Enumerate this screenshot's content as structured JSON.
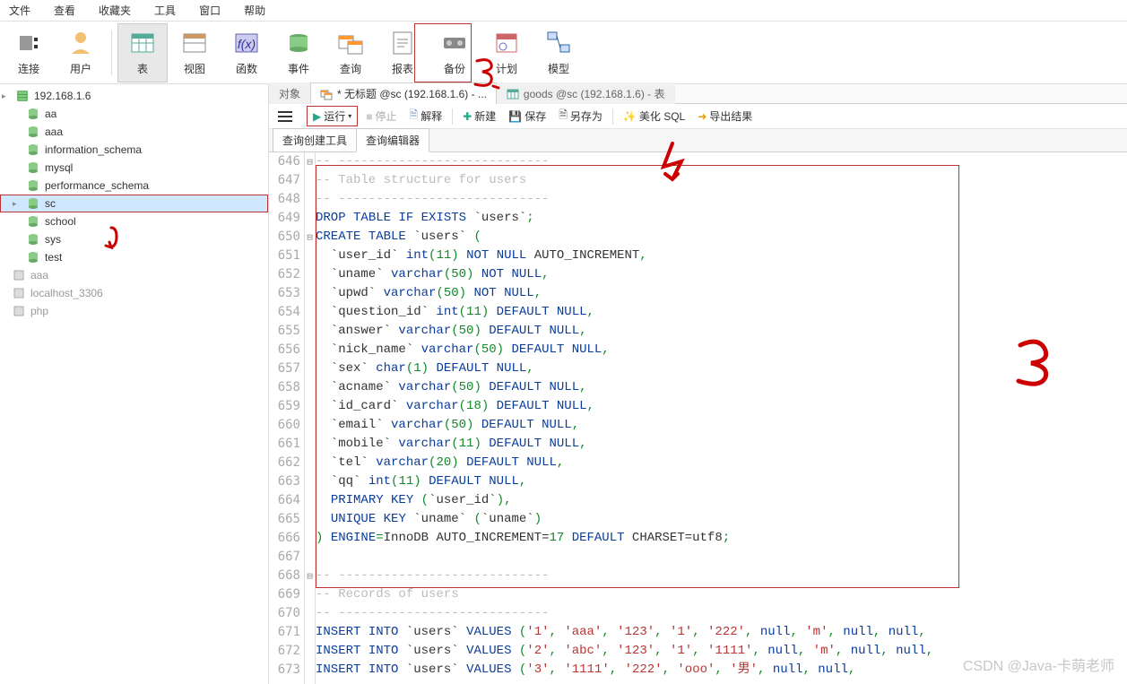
{
  "menubar": [
    "文件",
    "查看",
    "收藏夹",
    "工具",
    "窗口",
    "帮助"
  ],
  "main_toolbar": [
    {
      "label": "连接",
      "icon": "plug",
      "selected": false
    },
    {
      "label": "用户",
      "icon": "user",
      "selected": false
    },
    {
      "sep": true
    },
    {
      "label": "表",
      "icon": "table",
      "selected": true
    },
    {
      "label": "视图",
      "icon": "view",
      "selected": false
    },
    {
      "label": "函数",
      "icon": "fx",
      "selected": false
    },
    {
      "label": "事件",
      "icon": "event",
      "selected": false
    },
    {
      "label": "查询",
      "icon": "query",
      "selected": false
    },
    {
      "label": "报表",
      "icon": "report",
      "selected": false
    },
    {
      "label": "备份",
      "icon": "backup",
      "selected": false
    },
    {
      "label": "计划",
      "icon": "plan",
      "selected": false
    },
    {
      "label": "模型",
      "icon": "model",
      "selected": false
    }
  ],
  "sidebar": {
    "connection": "192.168.1.6",
    "databases": [
      {
        "name": "aa",
        "open": true
      },
      {
        "name": "aaa",
        "open": true
      },
      {
        "name": "information_schema",
        "open": true
      },
      {
        "name": "mysql",
        "open": true
      },
      {
        "name": "performance_schema",
        "open": true
      },
      {
        "name": "sc",
        "open": true,
        "selected": true,
        "boxed": true
      },
      {
        "name": "school",
        "open": true
      },
      {
        "name": "sys",
        "open": true
      },
      {
        "name": "test",
        "open": true
      }
    ],
    "other_conns": [
      "aaa",
      "localhost_3306",
      "php"
    ]
  },
  "tabs": [
    {
      "label": "对象",
      "active": false,
      "type": "normal"
    },
    {
      "label": "* 无标题 @sc (192.168.1.6) - ...",
      "active": true,
      "type": "query"
    },
    {
      "label": "goods @sc (192.168.1.6) - 表",
      "active": false,
      "type": "table"
    }
  ],
  "query_toolbar": {
    "run": "运行",
    "stop": "停止",
    "explain": "解释",
    "new": "新建",
    "save": "保存",
    "saveas": "另存为",
    "beautify": "美化 SQL",
    "export": "导出结果"
  },
  "subtabs": {
    "builder": "查询创建工具",
    "editor": "查询编辑器"
  },
  "line_start": 646,
  "code": [
    {
      "fold": "⊟",
      "tokens": [
        {
          "t": "-- ----------------------------",
          "c": "gy"
        }
      ]
    },
    {
      "tokens": [
        {
          "t": "-- Table structure for users",
          "c": "gy"
        }
      ]
    },
    {
      "tokens": [
        {
          "t": "-- ----------------------------",
          "c": "gy"
        }
      ]
    },
    {
      "tokens": [
        {
          "t": "DROP",
          "c": "kw"
        },
        {
          "t": " "
        },
        {
          "t": "TABLE",
          "c": "kw"
        },
        {
          "t": " "
        },
        {
          "t": "IF",
          "c": "kw"
        },
        {
          "t": " "
        },
        {
          "t": "EXISTS",
          "c": "kw"
        },
        {
          "t": " `users`"
        },
        {
          "t": ";",
          "c": "op"
        }
      ]
    },
    {
      "fold": "⊟",
      "tokens": [
        {
          "t": "CREATE",
          "c": "kw"
        },
        {
          "t": " "
        },
        {
          "t": "TABLE",
          "c": "kw"
        },
        {
          "t": " `users` "
        },
        {
          "t": "(",
          "c": "op"
        }
      ]
    },
    {
      "tokens": [
        {
          "t": "  `user_id` "
        },
        {
          "t": "int",
          "c": "ty"
        },
        {
          "t": "(",
          "c": "op"
        },
        {
          "t": "11",
          "c": "nm"
        },
        {
          "t": ")",
          "c": "op"
        },
        {
          "t": " "
        },
        {
          "t": "NOT",
          "c": "kw"
        },
        {
          "t": " "
        },
        {
          "t": "NULL",
          "c": "kw"
        },
        {
          "t": " AUTO_INCREMENT"
        },
        {
          "t": ",",
          "c": "op"
        }
      ]
    },
    {
      "tokens": [
        {
          "t": "  `uname` "
        },
        {
          "t": "varchar",
          "c": "ty"
        },
        {
          "t": "(",
          "c": "op"
        },
        {
          "t": "50",
          "c": "nm"
        },
        {
          "t": ")",
          "c": "op"
        },
        {
          "t": " "
        },
        {
          "t": "NOT",
          "c": "kw"
        },
        {
          "t": " "
        },
        {
          "t": "NULL",
          "c": "kw"
        },
        {
          "t": ",",
          "c": "op"
        }
      ]
    },
    {
      "tokens": [
        {
          "t": "  `upwd` "
        },
        {
          "t": "varchar",
          "c": "ty"
        },
        {
          "t": "(",
          "c": "op"
        },
        {
          "t": "50",
          "c": "nm"
        },
        {
          "t": ")",
          "c": "op"
        },
        {
          "t": " "
        },
        {
          "t": "NOT",
          "c": "kw"
        },
        {
          "t": " "
        },
        {
          "t": "NULL",
          "c": "kw"
        },
        {
          "t": ",",
          "c": "op"
        }
      ]
    },
    {
      "tokens": [
        {
          "t": "  `question_id` "
        },
        {
          "t": "int",
          "c": "ty"
        },
        {
          "t": "(",
          "c": "op"
        },
        {
          "t": "11",
          "c": "nm"
        },
        {
          "t": ")",
          "c": "op"
        },
        {
          "t": " "
        },
        {
          "t": "DEFAULT",
          "c": "kw"
        },
        {
          "t": " "
        },
        {
          "t": "NULL",
          "c": "kw"
        },
        {
          "t": ",",
          "c": "op"
        }
      ]
    },
    {
      "tokens": [
        {
          "t": "  `answer` "
        },
        {
          "t": "varchar",
          "c": "ty"
        },
        {
          "t": "(",
          "c": "op"
        },
        {
          "t": "50",
          "c": "nm"
        },
        {
          "t": ")",
          "c": "op"
        },
        {
          "t": " "
        },
        {
          "t": "DEFAULT",
          "c": "kw"
        },
        {
          "t": " "
        },
        {
          "t": "NULL",
          "c": "kw"
        },
        {
          "t": ",",
          "c": "op"
        }
      ]
    },
    {
      "tokens": [
        {
          "t": "  `nick_name` "
        },
        {
          "t": "varchar",
          "c": "ty"
        },
        {
          "t": "(",
          "c": "op"
        },
        {
          "t": "50",
          "c": "nm"
        },
        {
          "t": ")",
          "c": "op"
        },
        {
          "t": " "
        },
        {
          "t": "DEFAULT",
          "c": "kw"
        },
        {
          "t": " "
        },
        {
          "t": "NULL",
          "c": "kw"
        },
        {
          "t": ",",
          "c": "op"
        }
      ]
    },
    {
      "tokens": [
        {
          "t": "  `sex` "
        },
        {
          "t": "char",
          "c": "ty"
        },
        {
          "t": "(",
          "c": "op"
        },
        {
          "t": "1",
          "c": "nm"
        },
        {
          "t": ")",
          "c": "op"
        },
        {
          "t": " "
        },
        {
          "t": "DEFAULT",
          "c": "kw"
        },
        {
          "t": " "
        },
        {
          "t": "NULL",
          "c": "kw"
        },
        {
          "t": ",",
          "c": "op"
        }
      ]
    },
    {
      "tokens": [
        {
          "t": "  `acname` "
        },
        {
          "t": "varchar",
          "c": "ty"
        },
        {
          "t": "(",
          "c": "op"
        },
        {
          "t": "50",
          "c": "nm"
        },
        {
          "t": ")",
          "c": "op"
        },
        {
          "t": " "
        },
        {
          "t": "DEFAULT",
          "c": "kw"
        },
        {
          "t": " "
        },
        {
          "t": "NULL",
          "c": "kw"
        },
        {
          "t": ",",
          "c": "op"
        }
      ]
    },
    {
      "tokens": [
        {
          "t": "  `id_card` "
        },
        {
          "t": "varchar",
          "c": "ty"
        },
        {
          "t": "(",
          "c": "op"
        },
        {
          "t": "18",
          "c": "nm"
        },
        {
          "t": ")",
          "c": "op"
        },
        {
          "t": " "
        },
        {
          "t": "DEFAULT",
          "c": "kw"
        },
        {
          "t": " "
        },
        {
          "t": "NULL",
          "c": "kw"
        },
        {
          "t": ",",
          "c": "op"
        }
      ]
    },
    {
      "tokens": [
        {
          "t": "  `email` "
        },
        {
          "t": "varchar",
          "c": "ty"
        },
        {
          "t": "(",
          "c": "op"
        },
        {
          "t": "50",
          "c": "nm"
        },
        {
          "t": ")",
          "c": "op"
        },
        {
          "t": " "
        },
        {
          "t": "DEFAULT",
          "c": "kw"
        },
        {
          "t": " "
        },
        {
          "t": "NULL",
          "c": "kw"
        },
        {
          "t": ",",
          "c": "op"
        }
      ]
    },
    {
      "tokens": [
        {
          "t": "  `mobile` "
        },
        {
          "t": "varchar",
          "c": "ty"
        },
        {
          "t": "(",
          "c": "op"
        },
        {
          "t": "11",
          "c": "nm"
        },
        {
          "t": ")",
          "c": "op"
        },
        {
          "t": " "
        },
        {
          "t": "DEFAULT",
          "c": "kw"
        },
        {
          "t": " "
        },
        {
          "t": "NULL",
          "c": "kw"
        },
        {
          "t": ",",
          "c": "op"
        }
      ]
    },
    {
      "tokens": [
        {
          "t": "  `tel` "
        },
        {
          "t": "varchar",
          "c": "ty"
        },
        {
          "t": "(",
          "c": "op"
        },
        {
          "t": "20",
          "c": "nm"
        },
        {
          "t": ")",
          "c": "op"
        },
        {
          "t": " "
        },
        {
          "t": "DEFAULT",
          "c": "kw"
        },
        {
          "t": " "
        },
        {
          "t": "NULL",
          "c": "kw"
        },
        {
          "t": ",",
          "c": "op"
        }
      ]
    },
    {
      "tokens": [
        {
          "t": "  `qq` "
        },
        {
          "t": "int",
          "c": "ty"
        },
        {
          "t": "(",
          "c": "op"
        },
        {
          "t": "11",
          "c": "nm"
        },
        {
          "t": ")",
          "c": "op"
        },
        {
          "t": " "
        },
        {
          "t": "DEFAULT",
          "c": "kw"
        },
        {
          "t": " "
        },
        {
          "t": "NULL",
          "c": "kw"
        },
        {
          "t": ",",
          "c": "op"
        }
      ]
    },
    {
      "tokens": [
        {
          "t": "  "
        },
        {
          "t": "PRIMARY",
          "c": "kw"
        },
        {
          "t": " "
        },
        {
          "t": "KEY",
          "c": "kw"
        },
        {
          "t": " "
        },
        {
          "t": "(",
          "c": "op"
        },
        {
          "t": "`user_id`"
        },
        {
          "t": ")",
          "c": "op"
        },
        {
          "t": ",",
          "c": "op"
        }
      ]
    },
    {
      "tokens": [
        {
          "t": "  "
        },
        {
          "t": "UNIQUE",
          "c": "kw"
        },
        {
          "t": " "
        },
        {
          "t": "KEY",
          "c": "kw"
        },
        {
          "t": " `uname` "
        },
        {
          "t": "(",
          "c": "op"
        },
        {
          "t": "`uname`"
        },
        {
          "t": ")",
          "c": "op"
        }
      ]
    },
    {
      "tokens": [
        {
          "t": ")",
          "c": "op"
        },
        {
          "t": " "
        },
        {
          "t": "ENGINE",
          "c": "kw"
        },
        {
          "t": "=",
          "c": "op"
        },
        {
          "t": "InnoDB"
        },
        {
          "t": " AUTO_INCREMENT="
        },
        {
          "t": "17",
          "c": "nm"
        },
        {
          "t": " "
        },
        {
          "t": "DEFAULT",
          "c": "kw"
        },
        {
          "t": " CHARSET=utf8"
        },
        {
          "t": ";",
          "c": "op"
        }
      ]
    },
    {
      "tokens": [
        {
          "t": ""
        }
      ]
    },
    {
      "fold": "⊟",
      "tokens": [
        {
          "t": "-- ----------------------------",
          "c": "gy"
        }
      ]
    },
    {
      "tokens": [
        {
          "t": "-- Records of users",
          "c": "gy"
        }
      ]
    },
    {
      "tokens": [
        {
          "t": "-- ----------------------------",
          "c": "gy"
        }
      ]
    },
    {
      "tokens": [
        {
          "t": "INSERT",
          "c": "kw"
        },
        {
          "t": " "
        },
        {
          "t": "INTO",
          "c": "kw"
        },
        {
          "t": " `users` "
        },
        {
          "t": "VALUES",
          "c": "kw"
        },
        {
          "t": " "
        },
        {
          "t": "(",
          "c": "op"
        },
        {
          "t": "'1'",
          "c": "st"
        },
        {
          "t": ", ",
          "c": "op"
        },
        {
          "t": "'aaa'",
          "c": "st"
        },
        {
          "t": ", ",
          "c": "op"
        },
        {
          "t": "'123'",
          "c": "st"
        },
        {
          "t": ", ",
          "c": "op"
        },
        {
          "t": "'1'",
          "c": "st"
        },
        {
          "t": ", ",
          "c": "op"
        },
        {
          "t": "'222'",
          "c": "st"
        },
        {
          "t": ", ",
          "c": "op"
        },
        {
          "t": "null",
          "c": "kw"
        },
        {
          "t": ", ",
          "c": "op"
        },
        {
          "t": "'m'",
          "c": "st"
        },
        {
          "t": ", ",
          "c": "op"
        },
        {
          "t": "null",
          "c": "kw"
        },
        {
          "t": ", ",
          "c": "op"
        },
        {
          "t": "null",
          "c": "kw"
        },
        {
          "t": ", ",
          "c": "op"
        }
      ]
    },
    {
      "tokens": [
        {
          "t": "INSERT",
          "c": "kw"
        },
        {
          "t": " "
        },
        {
          "t": "INTO",
          "c": "kw"
        },
        {
          "t": " `users` "
        },
        {
          "t": "VALUES",
          "c": "kw"
        },
        {
          "t": " "
        },
        {
          "t": "(",
          "c": "op"
        },
        {
          "t": "'2'",
          "c": "st"
        },
        {
          "t": ", ",
          "c": "op"
        },
        {
          "t": "'abc'",
          "c": "st"
        },
        {
          "t": ", ",
          "c": "op"
        },
        {
          "t": "'123'",
          "c": "st"
        },
        {
          "t": ", ",
          "c": "op"
        },
        {
          "t": "'1'",
          "c": "st"
        },
        {
          "t": ", ",
          "c": "op"
        },
        {
          "t": "'1111'",
          "c": "st"
        },
        {
          "t": ", ",
          "c": "op"
        },
        {
          "t": "null",
          "c": "kw"
        },
        {
          "t": ", ",
          "c": "op"
        },
        {
          "t": "'m'",
          "c": "st"
        },
        {
          "t": ", ",
          "c": "op"
        },
        {
          "t": "null",
          "c": "kw"
        },
        {
          "t": ", ",
          "c": "op"
        },
        {
          "t": "null",
          "c": "kw"
        },
        {
          "t": ", ",
          "c": "op"
        }
      ]
    },
    {
      "tokens": [
        {
          "t": "INSERT",
          "c": "kw"
        },
        {
          "t": " "
        },
        {
          "t": "INTO",
          "c": "kw"
        },
        {
          "t": " `users` "
        },
        {
          "t": "VALUES",
          "c": "kw"
        },
        {
          "t": " "
        },
        {
          "t": "(",
          "c": "op"
        },
        {
          "t": "'3'",
          "c": "st"
        },
        {
          "t": ", ",
          "c": "op"
        },
        {
          "t": "'1111'",
          "c": "st"
        },
        {
          "t": ", ",
          "c": "op"
        },
        {
          "t": "'222'",
          "c": "st"
        },
        {
          "t": ", ",
          "c": "op"
        },
        {
          "t": "'ooo'",
          "c": "st"
        },
        {
          "t": ", ",
          "c": "op"
        },
        {
          "t": "'男'",
          "c": "st"
        },
        {
          "t": ", ",
          "c": "op"
        },
        {
          "t": "null",
          "c": "kw"
        },
        {
          "t": ", ",
          "c": "op"
        },
        {
          "t": "null",
          "c": "kw"
        },
        {
          "t": ", ",
          "c": "op"
        }
      ]
    }
  ],
  "annotations": {
    "ann1": "1",
    "ann2": "2",
    "ann3": "3",
    "ann4": "4"
  },
  "watermark": "CSDN @Java-卡萌老师"
}
